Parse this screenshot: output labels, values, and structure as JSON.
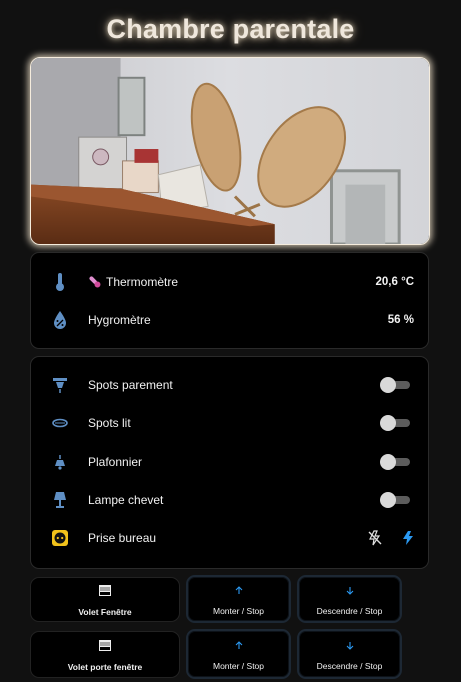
{
  "page": {
    "title": "Chambre parentale"
  },
  "camera": {
    "label": "Bedroom camera snapshot"
  },
  "sensors": [
    {
      "name": "Thermomètre",
      "value": "20,6 °C",
      "icon": "thermometer-icon"
    },
    {
      "name": "Hygromètre",
      "value": "56 %",
      "icon": "water-percent-icon"
    }
  ],
  "lights": [
    {
      "name": "Spots parement",
      "icon": "ceiling-spot-icon",
      "state": "off"
    },
    {
      "name": "Spots lit",
      "icon": "ceiling-ring-icon",
      "state": "off"
    },
    {
      "name": "Plafonnier",
      "icon": "ceiling-light-icon",
      "state": "off"
    },
    {
      "name": "Lampe chevet",
      "icon": "lamp-icon",
      "state": "off"
    }
  ],
  "outlet": {
    "name": "Prise bureau",
    "icon": "power-socket-icon",
    "off_icon": "flash-off-icon",
    "on_icon": "flash-icon"
  },
  "shutters": [
    {
      "name": "Volet Fenêtre",
      "up_label": "Monter / Stop",
      "down_label": "Descendre / Stop"
    },
    {
      "name": "Volet porte fenêtre",
      "up_label": "Monter / Stop",
      "down_label": "Descendre / Stop"
    }
  ],
  "colors": {
    "icon_blue": "#5f8fc4",
    "accent_blue": "#2b9af3",
    "outlet_yellow": "#f2c21b",
    "background": "#111111"
  }
}
